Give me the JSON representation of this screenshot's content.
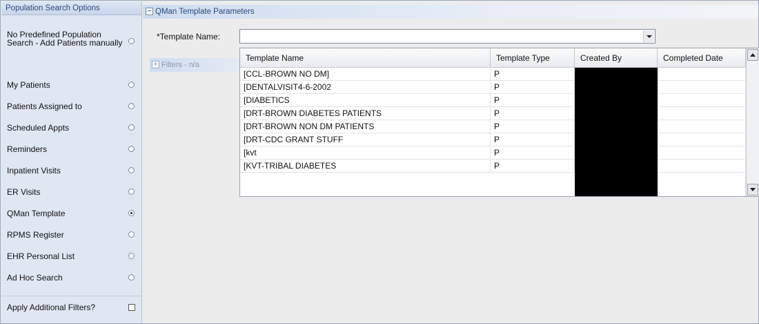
{
  "left_panel": {
    "title": "Population Search Options",
    "options": [
      {
        "label": "No Predefined Population Search - Add Patients manually",
        "checked": false
      },
      {
        "label": "My Patients",
        "checked": false
      },
      {
        "label": "Patients Assigned to",
        "checked": false
      },
      {
        "label": "Scheduled Appts",
        "checked": false
      },
      {
        "label": "Reminders",
        "checked": false
      },
      {
        "label": "Inpatient Visits",
        "checked": false
      },
      {
        "label": "ER Visits",
        "checked": false
      },
      {
        "label": "QMan Template",
        "checked": true
      },
      {
        "label": "RPMS Register",
        "checked": false
      },
      {
        "label": "EHR Personal List",
        "checked": false
      },
      {
        "label": "Ad Hoc Search",
        "checked": false
      }
    ],
    "additional_filters": {
      "label": "Apply Additional Filters?",
      "checked": false
    }
  },
  "params_panel": {
    "collapse_glyph": "−",
    "title": "QMan Template Parameters",
    "template_name_label": "*Template Name:",
    "template_name_value": "",
    "filters_glyph": "+",
    "filters_label": "Filters - n/a"
  },
  "grid": {
    "columns": [
      "Template Name",
      "Template Type",
      "Created By",
      "Completed Date"
    ],
    "rows": [
      {
        "name": "[CCL-BROWN NO DM]",
        "type": "P",
        "created_by": "",
        "completed": ""
      },
      {
        "name": "[DENTALVISIT4-6-2002",
        "type": "P",
        "created_by": "",
        "completed": ""
      },
      {
        "name": "[DIABETICS",
        "type": "P",
        "created_by": "",
        "completed": ""
      },
      {
        "name": "[DRT-BROWN DIABETES PATIENTS",
        "type": "P",
        "created_by": "",
        "completed": ""
      },
      {
        "name": "[DRT-BROWN NON DM PATIENTS",
        "type": "P",
        "created_by": "",
        "completed": ""
      },
      {
        "name": "[DRT-CDC GRANT STUFF",
        "type": "P",
        "created_by": "",
        "completed": ""
      },
      {
        "name": "[kvt",
        "type": "P",
        "created_by": "",
        "completed": ""
      },
      {
        "name": "[KVT-TRIBAL DIABETES",
        "type": "P",
        "created_by": "",
        "completed": ""
      }
    ]
  },
  "colors": {
    "panel_bg": "#dfe7f3",
    "header_text": "#2a4a7a",
    "redaction": "#000000"
  }
}
